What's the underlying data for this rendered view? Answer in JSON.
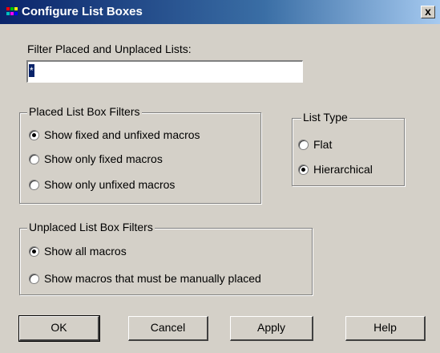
{
  "window": {
    "title": "Configure List Boxes",
    "close_label": "x"
  },
  "filter": {
    "label": "Filter Placed and Unplaced Lists:",
    "value": "*"
  },
  "placed_group": {
    "title": "Placed List Box Filters",
    "options": [
      {
        "label": "Show fixed and unfixed macros",
        "checked": true
      },
      {
        "label": "Show only fixed macros",
        "checked": false
      },
      {
        "label": "Show only unfixed macros",
        "checked": false
      }
    ]
  },
  "list_type_group": {
    "title": "List Type",
    "options": [
      {
        "label": "Flat",
        "checked": false
      },
      {
        "label": "Hierarchical",
        "checked": true
      }
    ]
  },
  "unplaced_group": {
    "title": "Unplaced List Box Filters",
    "options": [
      {
        "label": "Show all macros",
        "checked": true
      },
      {
        "label": "Show macros that must be manually placed",
        "checked": false
      }
    ]
  },
  "buttons": {
    "ok": "OK",
    "cancel": "Cancel",
    "apply": "Apply",
    "help": "Help"
  }
}
